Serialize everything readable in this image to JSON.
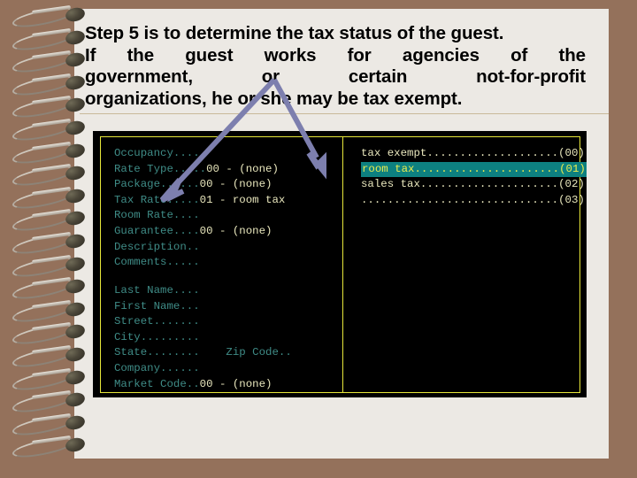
{
  "slide": {
    "heading_lines": [
      {
        "text": "Step 5 is to determine the tax status of the guest.",
        "justify": false
      },
      {
        "words": [
          "If",
          "the",
          "guest",
          "works",
          "for",
          "agencies",
          "of",
          "the"
        ],
        "justify": true
      },
      {
        "words": [
          "government,",
          "or",
          "certain",
          "not-for-profit"
        ],
        "justify": true
      },
      {
        "text": "organizations, he or she may be tax exempt.",
        "justify": false
      }
    ],
    "heading_text_full": "Step 5 is to determine the tax status of the guest. If the guest works for agencies of the government, or certain not-for-profit organizations, he or she may be tax exempt."
  },
  "terminal": {
    "left_panel": {
      "group1": [
        {
          "label": "Occupancy....",
          "value": ""
        },
        {
          "label": "Rate Type.....",
          "value": "00 - (none)"
        },
        {
          "label": "Package......",
          "value": "00 - (none)"
        },
        {
          "label": "Tax Rate.....",
          "value": "01 - room tax"
        },
        {
          "label": "Room Rate....",
          "value": ""
        },
        {
          "label": "Guarantee....",
          "value": "00 - (none)"
        },
        {
          "label": "Description..",
          "value": ""
        },
        {
          "label": "Comments.....",
          "value": ""
        }
      ],
      "group2": [
        {
          "label": "Last Name....",
          "value": ""
        },
        {
          "label": "First Name...",
          "value": ""
        },
        {
          "label": "Street.......",
          "value": ""
        },
        {
          "label": "City.........",
          "value": ""
        },
        {
          "label": "State........",
          "value": "",
          "label2": "Zip Code..",
          "value2": ""
        },
        {
          "label": "Company......",
          "value": ""
        },
        {
          "label": "Market Code..",
          "value": "00 - (none)"
        }
      ]
    },
    "right_panel": {
      "options": [
        {
          "label": "tax exempt",
          "dots": "....................",
          "code": "(00)",
          "selected": false
        },
        {
          "label": "room tax",
          "dots": "......................",
          "code": "(01)",
          "selected": true
        },
        {
          "label": "sales tax",
          "dots": ".....................",
          "code": "(02)",
          "selected": false
        },
        {
          "label": "",
          "dots": "..............................",
          "code": "(03)",
          "selected": false
        }
      ]
    }
  },
  "annotation": {
    "arrow_name": "chevron-double-arrow",
    "arrow_color": "#7d7fae",
    "points_to_left": "Tax Rate field",
    "points_to_right": "room tax option"
  },
  "colors": {
    "cover_brown": "#94715b",
    "paper": "#ece9e4",
    "terminal_bg": "#000000",
    "terminal_border": "#e8e83a",
    "label_teal": "#3f8c87",
    "value_cream": "#e9e7bd",
    "highlight_bg": "#0d8080",
    "highlight_fg": "#ecec4e",
    "arrow": "#7d7fae"
  }
}
